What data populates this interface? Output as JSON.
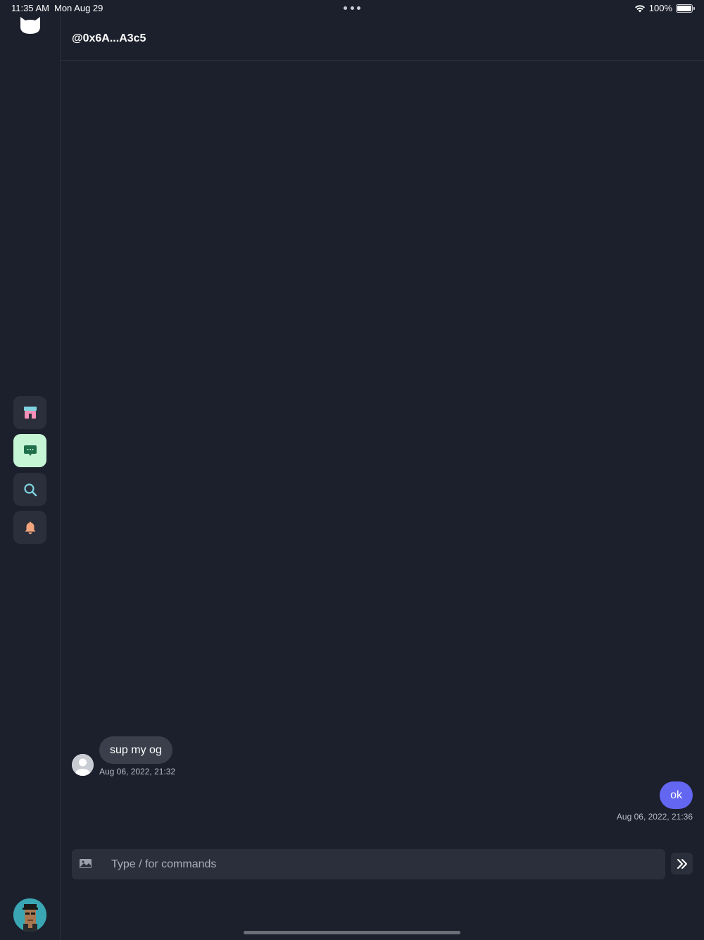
{
  "status_bar": {
    "time": "11:35 AM",
    "date": "Mon Aug 29",
    "battery": "100%"
  },
  "header": {
    "title": "@0x6A...A3c5"
  },
  "sidebar": {
    "items": [
      {
        "name": "store",
        "icon": "store-icon",
        "active": false
      },
      {
        "name": "messages",
        "icon": "chat-icon",
        "active": true
      },
      {
        "name": "search",
        "icon": "search-icon",
        "active": false
      },
      {
        "name": "notifications",
        "icon": "bell-icon",
        "active": false
      }
    ]
  },
  "messages": [
    {
      "direction": "incoming",
      "text": "sup my og",
      "timestamp": "Aug 06, 2022, 21:32"
    },
    {
      "direction": "outgoing",
      "text": "ok",
      "timestamp": "Aug 06, 2022, 21:36"
    }
  ],
  "composer": {
    "placeholder": "Type / for commands"
  },
  "colors": {
    "background": "#1c202c",
    "panel": "#2a2f3b",
    "accent": "#6366f1",
    "active_nav": "#c6f5d5",
    "incoming_bubble": "#3a3f4b"
  }
}
